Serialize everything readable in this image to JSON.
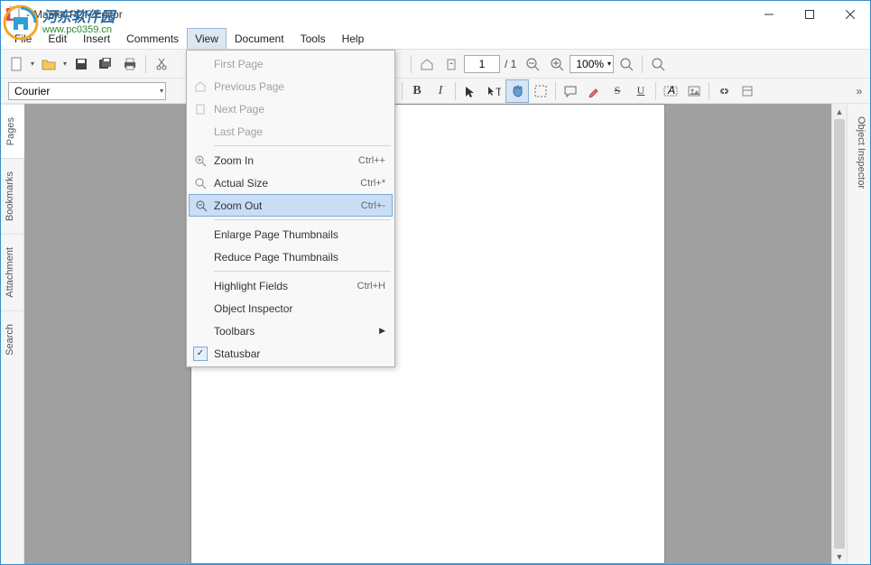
{
  "window": {
    "title": "Master PDF Editor"
  },
  "watermark": {
    "text_cn": "河东软件园",
    "url": "www.pc0359.cn"
  },
  "menubar": {
    "items": [
      "File",
      "Edit",
      "Insert",
      "Comments",
      "View",
      "Document",
      "Tools",
      "Help"
    ],
    "open_index": 4
  },
  "view_menu": {
    "items": [
      {
        "label": "First Page",
        "icon": "first",
        "disabled": true
      },
      {
        "label": "Previous Page",
        "icon": "home",
        "disabled": true
      },
      {
        "label": "Next Page",
        "icon": "doc",
        "disabled": true
      },
      {
        "label": "Last Page",
        "disabled": true
      },
      {
        "sep": true
      },
      {
        "label": "Zoom In",
        "icon": "zoom-in",
        "shortcut": "Ctrl++"
      },
      {
        "label": "Actual Size",
        "icon": "zoom-actual",
        "shortcut": "Ctrl+*"
      },
      {
        "label": "Zoom Out",
        "icon": "zoom-out",
        "shortcut": "Ctrl+-",
        "highlight": true
      },
      {
        "sep": true
      },
      {
        "label": "Enlarge Page Thumbnails"
      },
      {
        "label": "Reduce Page Thumbnails"
      },
      {
        "sep": true
      },
      {
        "label": "Highlight Fields",
        "shortcut": "Ctrl+H"
      },
      {
        "label": "Object Inspector"
      },
      {
        "label": "Toolbars",
        "submenu": true
      },
      {
        "label": "Statusbar",
        "checked": true
      }
    ]
  },
  "toolbar1": {
    "page_input": "1",
    "page_total": "/ 1",
    "zoom_value": "100%"
  },
  "toolbar2": {
    "font": "Courier"
  },
  "left_tabs": [
    "Pages",
    "Bookmarks",
    "Attachment",
    "Search"
  ],
  "right_tabs": [
    "Object Inspector"
  ]
}
